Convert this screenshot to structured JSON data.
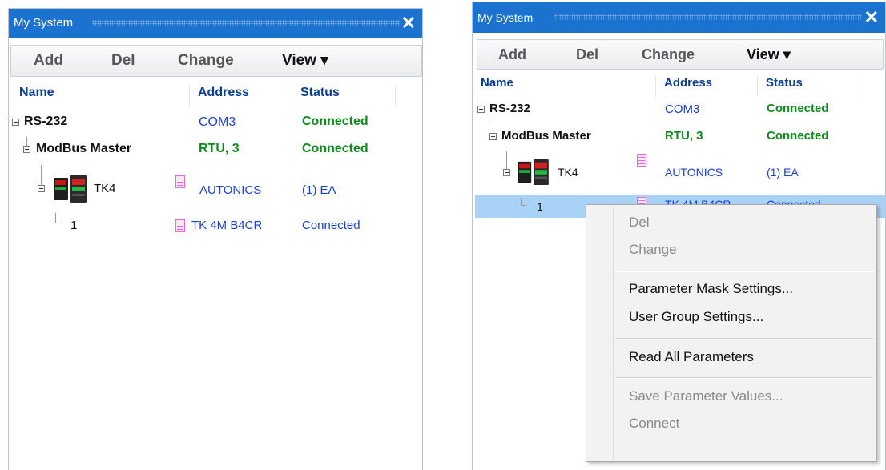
{
  "panel_title": "My System",
  "toolbar": {
    "add": "Add",
    "del": "Del",
    "change": "Change",
    "view": "View ▾"
  },
  "columns": {
    "name": "Name",
    "address": "Address",
    "status": "Status"
  },
  "tree": {
    "rs232": {
      "name": "RS-232",
      "address": "COM3",
      "status": "Connected"
    },
    "modbus": {
      "name": "ModBus Master",
      "address": "RTU, 3",
      "status": "Connected"
    },
    "tk4": {
      "name": "TK4",
      "address": "AUTONICS",
      "status": "(1) EA"
    },
    "unit1": {
      "name": "1",
      "address": "TK 4M B4CR",
      "status": "Connected"
    }
  },
  "close_glyph": "✕",
  "context_menu": {
    "items": [
      {
        "label": "Del",
        "enabled": false
      },
      {
        "label": "Change",
        "enabled": false
      },
      {
        "label": "Parameter Mask Settings...",
        "enabled": true
      },
      {
        "label": "User Group Settings...",
        "enabled": true
      },
      {
        "label": "Read All Parameters",
        "enabled": true
      },
      {
        "label": "Save Parameter Values...",
        "enabled": false
      },
      {
        "label": "Connect",
        "enabled": false
      }
    ]
  },
  "colors": {
    "titlebar": "#1b73cf",
    "selection": "#a9d2f7",
    "connected": "#0f8a1d",
    "address": "#1c3fcf",
    "param_icon": "#e46ad1"
  },
  "icons": [
    "close-icon",
    "dropdown-arrow-icon",
    "collapse-icon",
    "temperature-controller-icon",
    "parameter-icon"
  ]
}
